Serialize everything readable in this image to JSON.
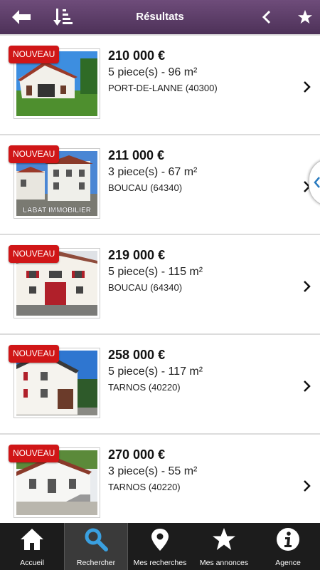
{
  "topbar": {
    "title": "Résultats"
  },
  "badge_label": "NOUVEAU",
  "listings": [
    {
      "price": "210 000 €",
      "rooms": "5 piece(s) - 96 m²",
      "city": "PORT-DE-LANNE (40300)"
    },
    {
      "price": "211 000 €",
      "rooms": "3 piece(s) - 67 m²",
      "city": "BOUCAU (64340)",
      "watermark": "LABAT IMMOBILIER"
    },
    {
      "price": "219 000 €",
      "rooms": "5 piece(s) - 115 m²",
      "city": "BOUCAU (64340)"
    },
    {
      "price": "258 000 €",
      "rooms": "5 piece(s) - 117 m²",
      "city": "TARNOS (40220)"
    },
    {
      "price": "270 000 €",
      "rooms": "3 piece(s) - 55 m²",
      "city": "TARNOS (40220)"
    }
  ],
  "bottom_nav": [
    {
      "label": "Accueil",
      "icon": "home-icon"
    },
    {
      "label": "Rechercher",
      "icon": "search-icon",
      "active": true
    },
    {
      "label": "Mes recherches",
      "icon": "map-pin-icon"
    },
    {
      "label": "Mes annonces",
      "icon": "star-icon"
    },
    {
      "label": "Agence",
      "icon": "info-icon"
    }
  ],
  "colors": {
    "topbar": "#5d3d69",
    "badge": "#d01617",
    "sidetab_arrow": "#2a7bbf",
    "bottombar": "#1c1c1c",
    "active_icon": "#3aa0e0"
  }
}
